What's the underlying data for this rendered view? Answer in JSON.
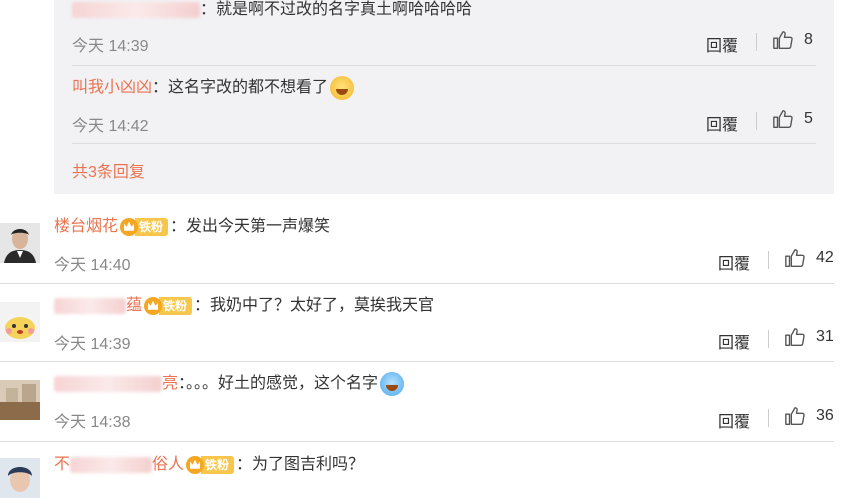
{
  "reply_block": {
    "replies": [
      {
        "user_visible": "",
        "text": "：就是啊不过改的名字真土啊哈哈哈哈",
        "time": "今天 14:39",
        "reply_label": "回覆",
        "likes": "8"
      },
      {
        "user_visible": "叫我小凶凶",
        "text": "：这名字改的都不想看了",
        "time": "今天 14:42",
        "reply_label": "回覆",
        "likes": "5",
        "emoji": "laugh-cry-emoji"
      }
    ],
    "more_label": "共3条回复"
  },
  "comments": [
    {
      "user_visible": "楼台烟花",
      "badge_label": "铁粉",
      "text": "：发出今天第一声爆笑",
      "time": "今天 14:40",
      "reply_label": "回覆",
      "likes": "42"
    },
    {
      "user_visible": "蕴",
      "badge_label": "铁粉",
      "text": "：我奶中了？太好了，莫挨我天官",
      "time": "今天 14:39",
      "reply_label": "回覆",
      "likes": "31"
    },
    {
      "user_visible": "亮",
      "text": "：。。。好土的感觉，这个名字",
      "time": "今天 14:38",
      "reply_label": "回覆",
      "likes": "36",
      "emoji": "laugh-cry-emoji"
    },
    {
      "user_visible_prefix": "不",
      "user_visible": "俗人",
      "badge_label": "铁粉",
      "text": "：为了图吉利吗？"
    }
  ],
  "colors": {
    "accent": "#eb7350",
    "reply_bg": "#f2f2f5",
    "badge": "#f7c64b"
  }
}
